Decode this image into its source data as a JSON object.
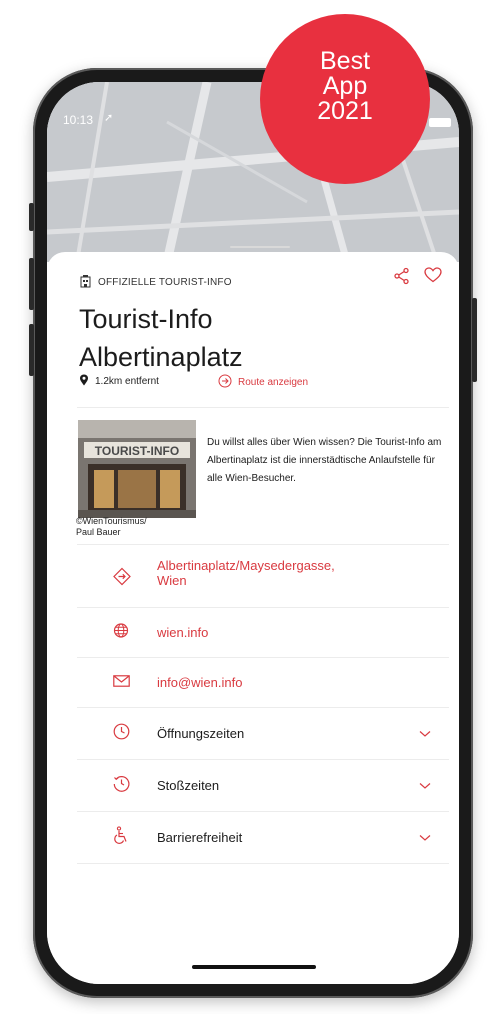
{
  "badge": {
    "line1": "Best",
    "line2": "App",
    "line3": "2021"
  },
  "status": {
    "time": "10:13"
  },
  "sheet": {
    "category": "OFFIZIELLE TOURIST-INFO",
    "title_line1": "Tourist-Info",
    "title_line2": "Albertinaplatz",
    "distance": "1.2km entfernt",
    "route_label": "Route anzeigen",
    "description": "Du willst alles über Wien wissen? Die Tourist-Info am Albertinaplatz ist die innerstädtische Anlaufstelle für alle Wien-Besucher.",
    "photo_caption_line1": "©WienTourismus/",
    "photo_caption_line2": "Paul Bauer",
    "photo_sign": "TOURIST-INFO",
    "address_line1": "Albertinaplatz/Maysedergasse,",
    "address_line2": "Wien",
    "website": "wien.info",
    "email": "info@wien.info",
    "opening_hours": "Öffnungszeiten",
    "peak_times": "Stoßzeiten",
    "accessibility": "Barrierefreiheit"
  },
  "colors": {
    "accent": "#d93a40",
    "badge": "#e8303f"
  }
}
